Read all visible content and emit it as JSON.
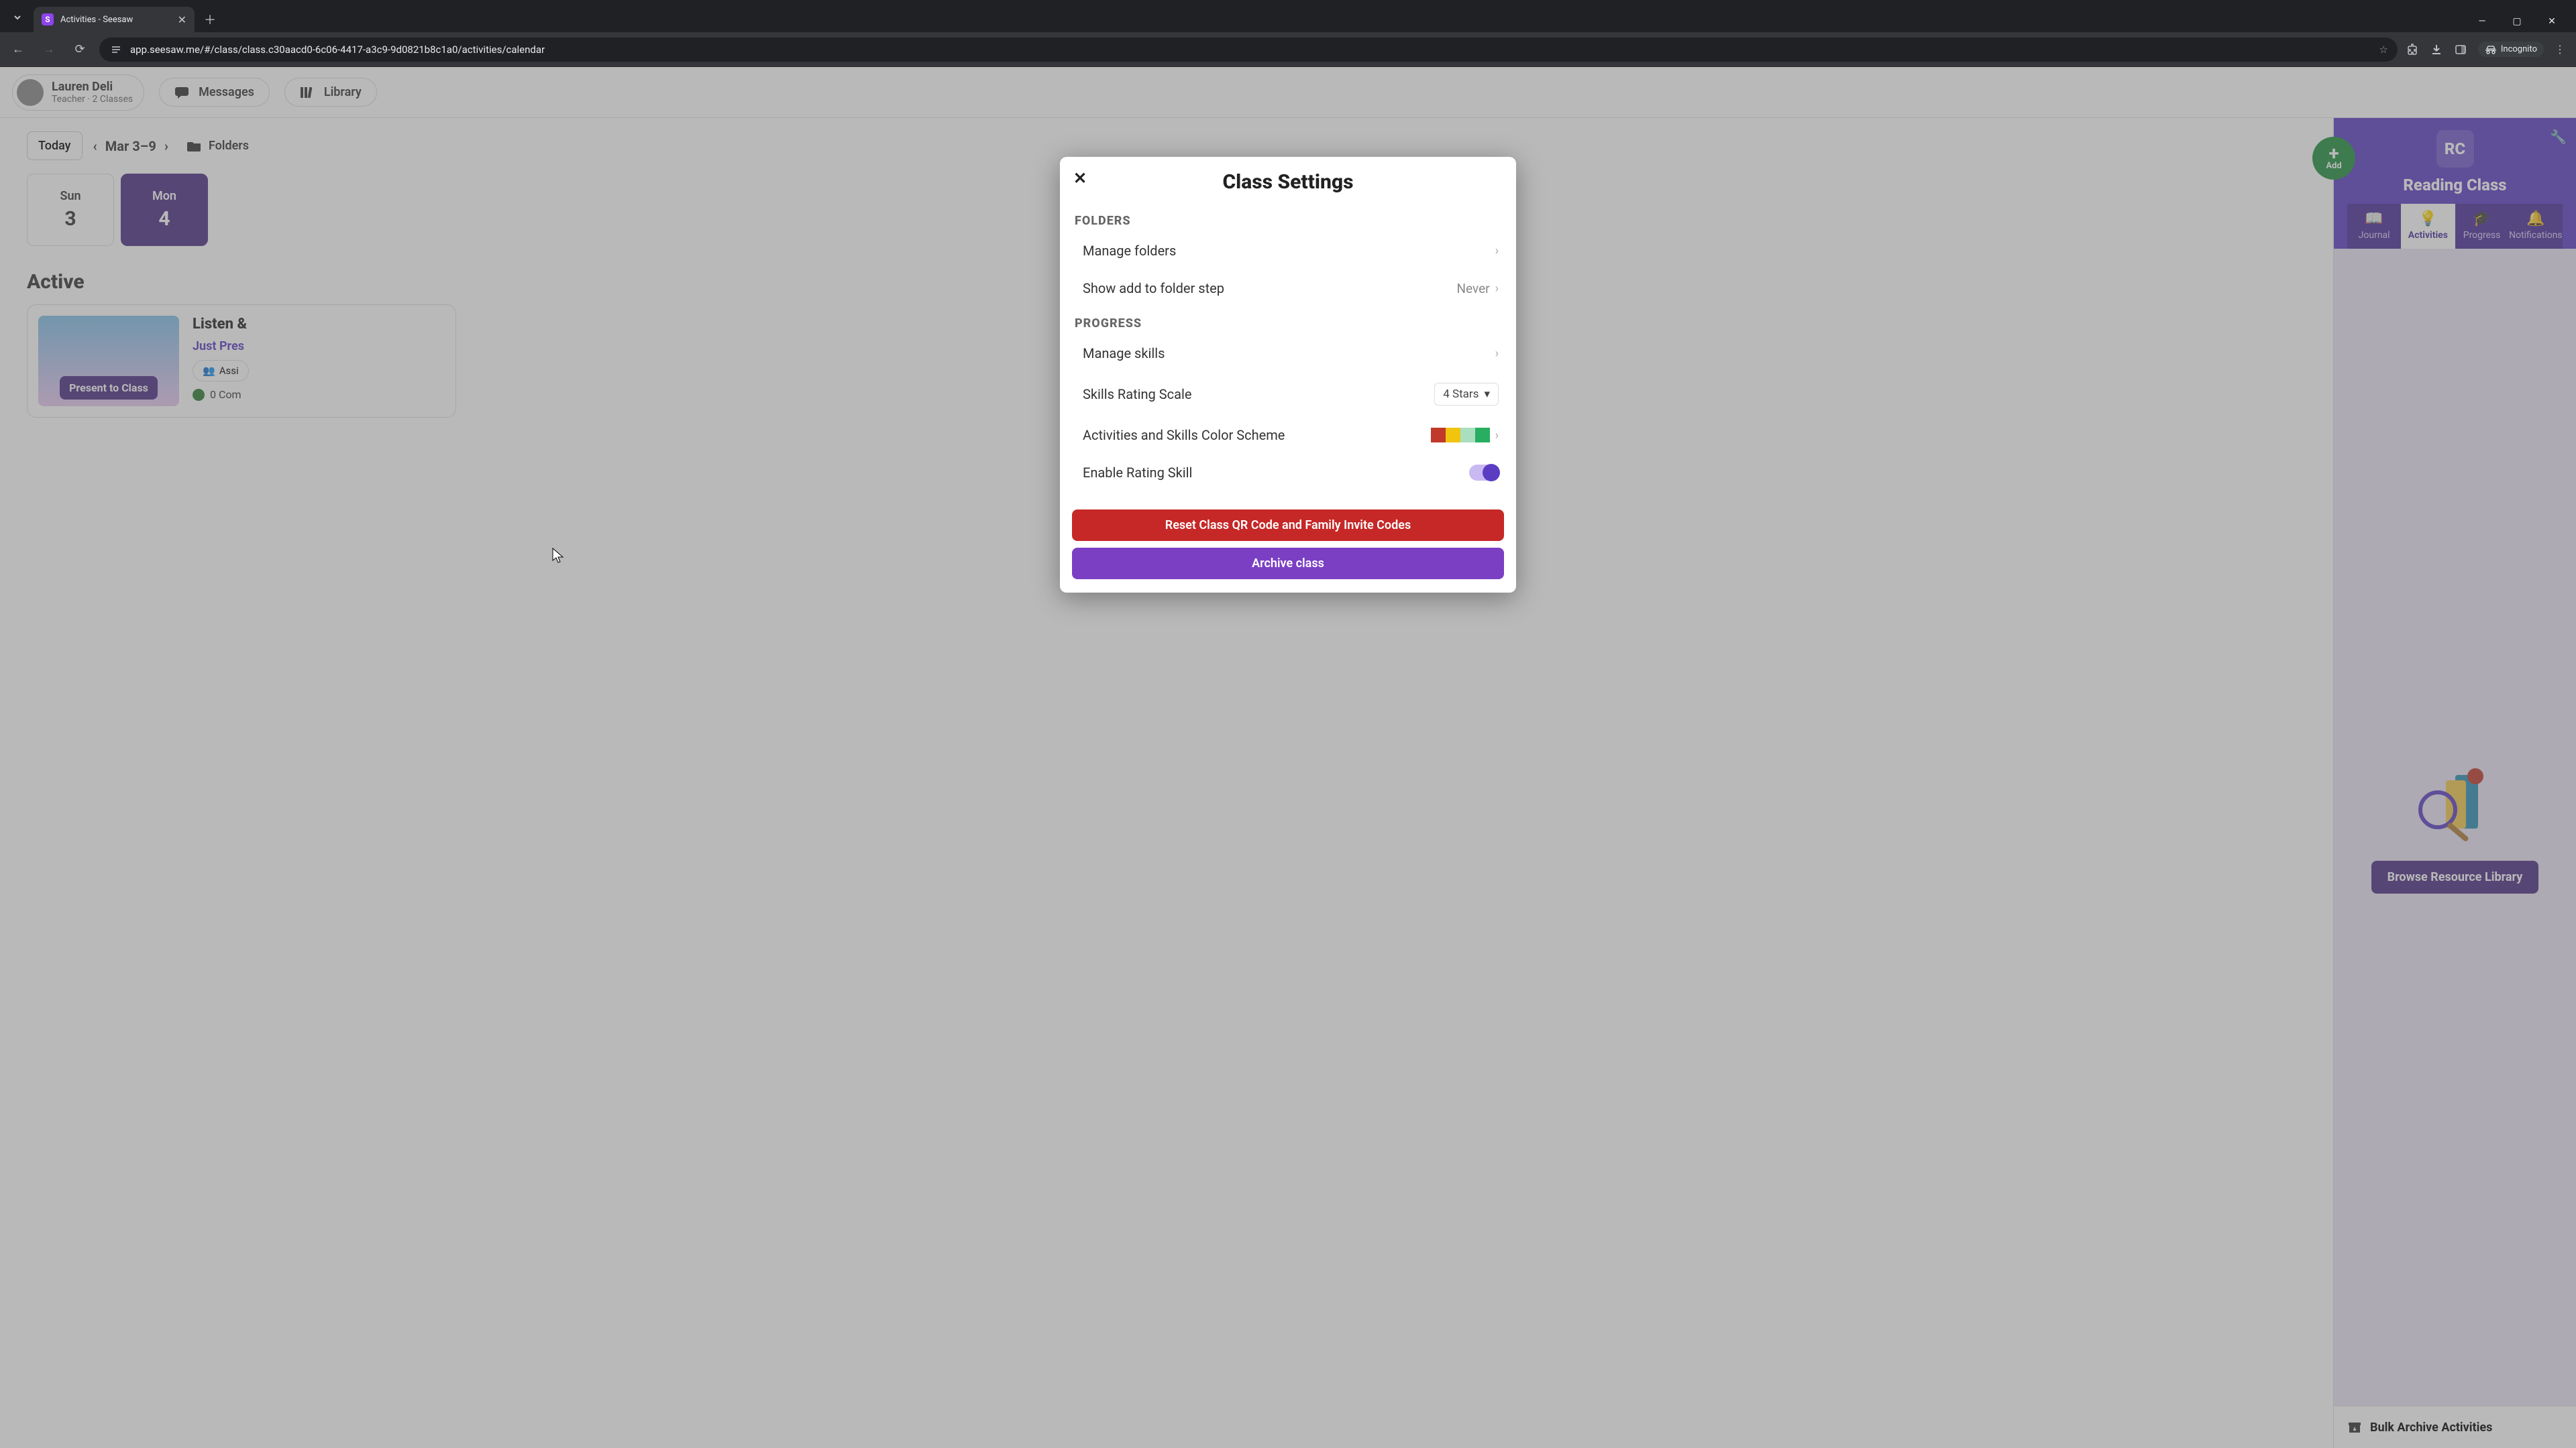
{
  "browser": {
    "tab_title": "Activities - Seesaw",
    "url": "app.seesaw.me/#/class/class.c30aacd0-6c06-4417-a3c9-9d0821b8c1a0/activities/calendar",
    "incognito_label": "Incognito"
  },
  "header": {
    "user_name": "Lauren Deli",
    "user_role": "Teacher · 2 Classes",
    "messages_label": "Messages",
    "library_label": "Library"
  },
  "datebar": {
    "today_label": "Today",
    "range_label": "Mar 3–9",
    "folders_label": "Folders"
  },
  "week": [
    {
      "dow": "Sun",
      "num": "3",
      "active": false
    },
    {
      "dow": "Mon",
      "num": "4",
      "active": true
    }
  ],
  "section_active_label": "Active",
  "activity": {
    "title": "Listen &",
    "subtitle": "Just Pres",
    "assign_label": "Assi",
    "complete_label": "0 Com",
    "present_label": "Present to Class"
  },
  "sidebar": {
    "add_label": "Add",
    "class_badge": "RC",
    "class_name": "Reading Class",
    "tabs": {
      "journal": "Journal",
      "activities": "Activities",
      "progress": "Progress",
      "notifications": "Notifications"
    },
    "browse_label": "Browse Resource Library",
    "bulk_label": "Bulk Archive Activities"
  },
  "modal": {
    "title": "Class Settings",
    "folders_header": "FOLDERS",
    "manage_folders": "Manage folders",
    "show_add_folder": "Show add to folder step",
    "show_add_folder_value": "Never",
    "progress_header": "PROGRESS",
    "manage_skills": "Manage skills",
    "rating_scale": "Skills Rating Scale",
    "rating_scale_value": "4 Stars",
    "color_scheme": "Activities and Skills Color Scheme",
    "color_swatches": [
      "#c0392b",
      "#f1c40f",
      "#a9dfbf",
      "#27ae60"
    ],
    "enable_rating": "Enable Rating Skill",
    "reset_label": "Reset Class QR Code and Family Invite Codes",
    "archive_label": "Archive class"
  }
}
